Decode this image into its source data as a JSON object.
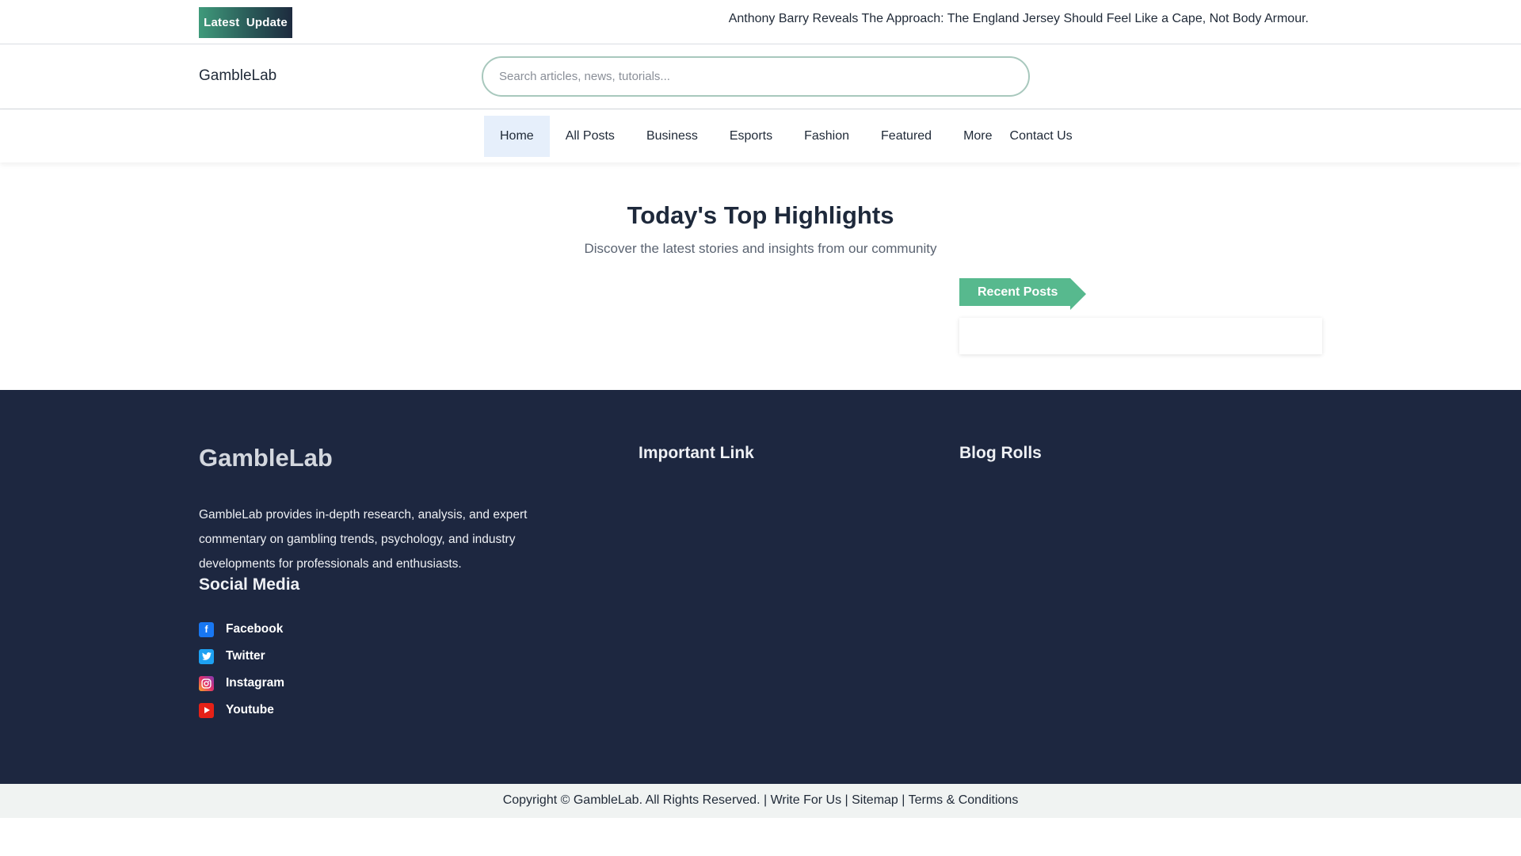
{
  "topbar": {
    "badge": "Latest Update",
    "ticker": "Anthony Barry Reveals The Approach: The England Jersey Should Feel Like a Cape, Not Body Armour."
  },
  "header": {
    "logo": "GambleLab",
    "search_placeholder": "Search articles, news, tutorials..."
  },
  "nav": {
    "items": [
      "Home",
      "All Posts",
      "Business",
      "Esports",
      "Fashion",
      "Featured",
      "More"
    ],
    "contact": "Contact Us"
  },
  "main": {
    "title": "Today's Top Highlights",
    "subtitle": "Discover the latest stories and insights from our community",
    "recent_posts_label": "Recent Posts"
  },
  "footer": {
    "logo": "GambleLab",
    "description": "GambleLab provides in-depth research, analysis, and expert commentary on gambling trends, psychology, and industry developments for professionals and enthusiasts.",
    "important_link_title": "Important Link",
    "blog_rolls_title": "Blog Rolls",
    "social_title": "Social Media",
    "social": [
      {
        "label": "Facebook",
        "icon": "facebook-icon",
        "color": "#1877f2"
      },
      {
        "label": "Twitter",
        "icon": "twitter-icon",
        "color": "#1da1f2"
      },
      {
        "label": "Instagram",
        "icon": "instagram-icon",
        "color": "#e1306c"
      },
      {
        "label": "Youtube",
        "icon": "youtube-icon",
        "color": "#e62117"
      }
    ]
  },
  "bottom": {
    "copyright": "Copyright © GambleLab. All Rights Reserved.",
    "sep": "|",
    "write_for_us": "Write For Us",
    "sitemap": "Sitemap",
    "terms": "Terms & Conditions"
  },
  "colors": {
    "accent": "#57b98e",
    "footer_bg": "#1d2740",
    "nav_active_bg": "#e6effb"
  }
}
